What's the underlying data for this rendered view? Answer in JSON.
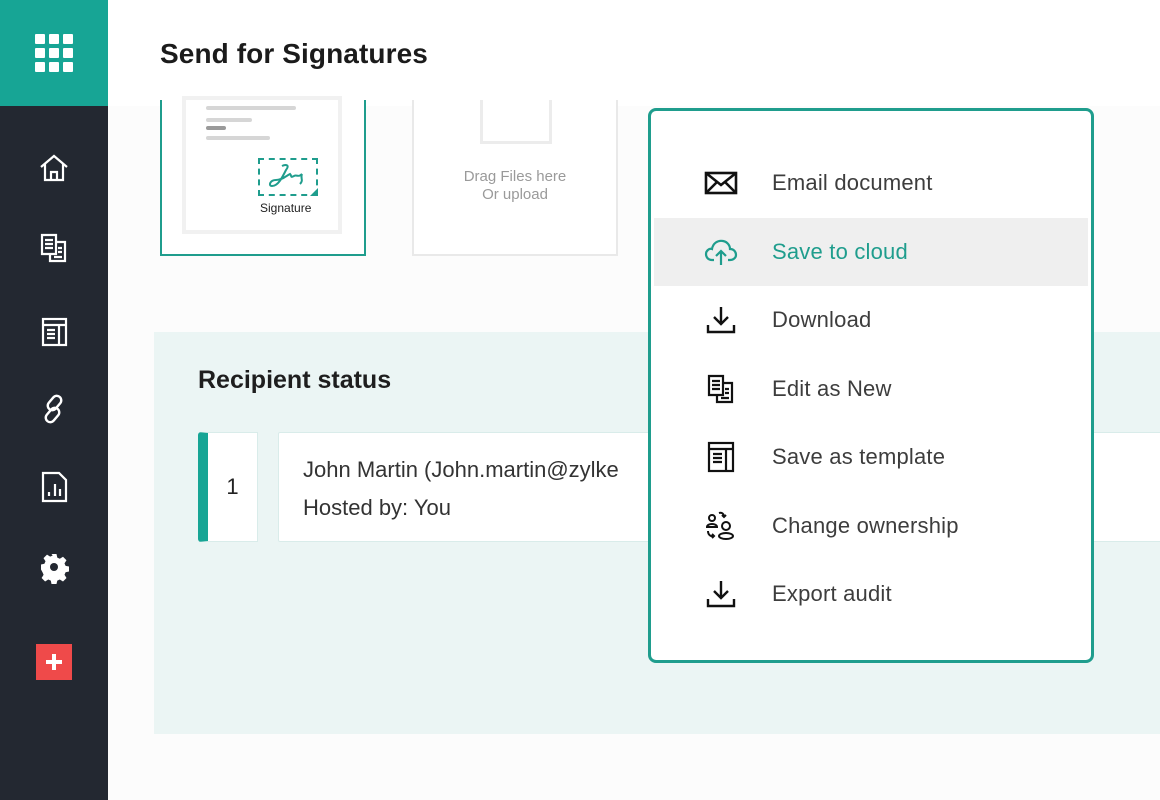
{
  "app": {
    "title": "Send for Signatures",
    "accent_color": "#17a595",
    "sidebar_bg": "#232831",
    "add_button_color": "#ef4a4a"
  },
  "sidebar": {
    "items": [
      {
        "name": "home",
        "icon": "home-icon"
      },
      {
        "name": "documents",
        "icon": "documents-icon"
      },
      {
        "name": "templates",
        "icon": "template-icon"
      },
      {
        "name": "links",
        "icon": "link-icon"
      },
      {
        "name": "reports",
        "icon": "report-icon"
      },
      {
        "name": "settings",
        "icon": "gear-icon"
      }
    ],
    "add_icon": "plus-icon"
  },
  "documents": {
    "signature_card_label": "Signature",
    "upload_text_line1": "Drag Files here",
    "upload_text_line2": "Or upload"
  },
  "recipients": {
    "title": "Recipient status",
    "list": [
      {
        "order": "1",
        "name": "John Martin (John.martin@zylke",
        "hosted_by": "Hosted by: You"
      }
    ]
  },
  "menu": {
    "items": [
      {
        "label": "Email document",
        "icon": "envelope-icon",
        "active": false
      },
      {
        "label": "Save to cloud",
        "icon": "cloud-upload-icon",
        "active": true
      },
      {
        "label": "Download",
        "icon": "download-icon",
        "active": false
      },
      {
        "label": "Edit as New",
        "icon": "documents-icon",
        "active": false
      },
      {
        "label": "Save as template",
        "icon": "template-icon",
        "active": false
      },
      {
        "label": "Change ownership",
        "icon": "change-owner-icon",
        "active": false
      },
      {
        "label": "Export audit",
        "icon": "export-icon",
        "active": false
      }
    ]
  }
}
